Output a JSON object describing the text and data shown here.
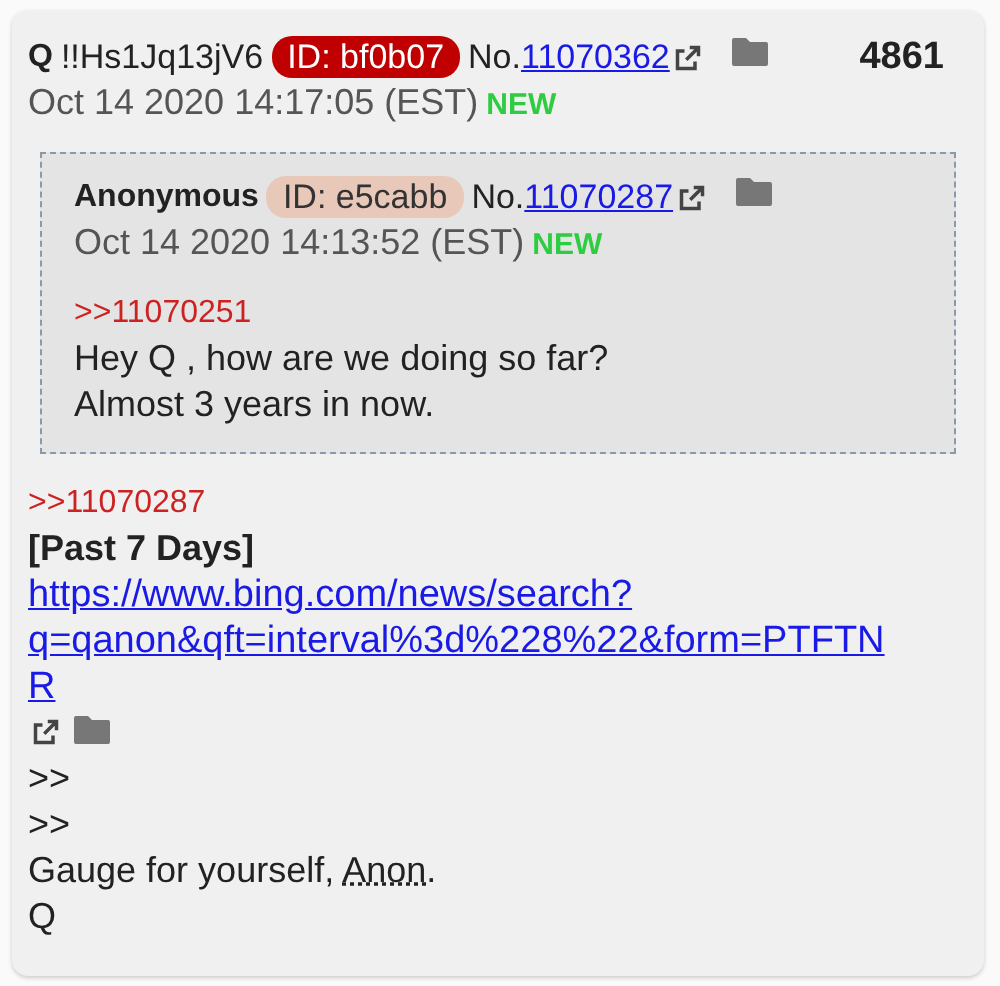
{
  "post": {
    "name": "Q",
    "tripcode": "!!Hs1Jq13jV6",
    "id": {
      "text": "ID: bf0b07",
      "color": "#c00000"
    },
    "no_label": "No.",
    "number": "11070362",
    "count": "4861",
    "date": "Oct 14 2020 14:17:05 (EST)",
    "new_label": "NEW",
    "quoted": {
      "name": "Anonymous",
      "id": {
        "text": "ID: e5cabb",
        "color": "#e8c8b8"
      },
      "no_label": "No.",
      "number": "11070287",
      "date": "Oct 14 2020 14:13:52 (EST)",
      "new_label": "NEW",
      "body": [
        {
          "kind": "quote",
          "text": ">>11070251"
        },
        {
          "kind": "text",
          "segments": [
            {
              "text": "Hey Q , how are we doing so far?"
            }
          ]
        },
        {
          "kind": "text",
          "segments": [
            {
              "text": "Almost 3 years in now."
            }
          ]
        }
      ]
    },
    "body": [
      {
        "kind": "quote",
        "text": ">>11070287"
      },
      {
        "kind": "bold",
        "text": "[Past 7 Days]"
      },
      {
        "kind": "link",
        "text": "https://www.bing.com/news/search?q=qanon&qft=interval%3d%228%22&form=PTFTNR"
      },
      {
        "kind": "text",
        "segments": [
          {
            "text": ">>"
          }
        ]
      },
      {
        "kind": "text",
        "segments": [
          {
            "text": ">>"
          }
        ]
      },
      {
        "kind": "text",
        "segments": [
          {
            "text": "Gauge for yourself, "
          },
          {
            "text": "Anon",
            "abbr": true
          },
          {
            "text": "."
          }
        ]
      },
      {
        "kind": "text",
        "segments": [
          {
            "text": "Q"
          }
        ]
      }
    ]
  }
}
